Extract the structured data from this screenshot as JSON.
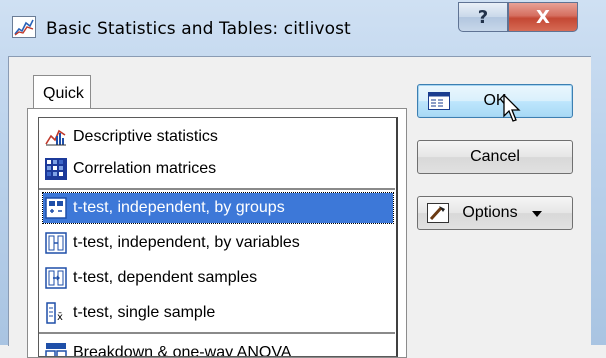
{
  "window": {
    "title": "Basic Statistics and Tables: citlivost",
    "help_label": "?",
    "close_label": "X"
  },
  "tabs": [
    {
      "label": "Quick"
    }
  ],
  "list": {
    "items": [
      {
        "label": "Descriptive statistics",
        "icon": "chart-icon",
        "selected": false
      },
      {
        "label": "Correlation matrices",
        "icon": "matrix-icon",
        "selected": false
      },
      {
        "label": "t-test, independent, by groups",
        "icon": "ttest-groups-icon",
        "selected": true
      },
      {
        "label": "t-test, independent, by variables",
        "icon": "ttest-variables-icon",
        "selected": false
      },
      {
        "label": "t-test, dependent samples",
        "icon": "ttest-dependent-icon",
        "selected": false
      },
      {
        "label": "t-test, single sample",
        "icon": "ttest-single-icon",
        "selected": false
      },
      {
        "label": "Breakdown & one-way ANOVA",
        "icon": "breakdown-icon",
        "selected": false
      }
    ]
  },
  "buttons": {
    "ok": "OK",
    "cancel": "Cancel",
    "options": "Options"
  },
  "colors": {
    "selection": "#3d78d8",
    "close_button": "#c44834",
    "title_bar": "#bcd3ec"
  }
}
